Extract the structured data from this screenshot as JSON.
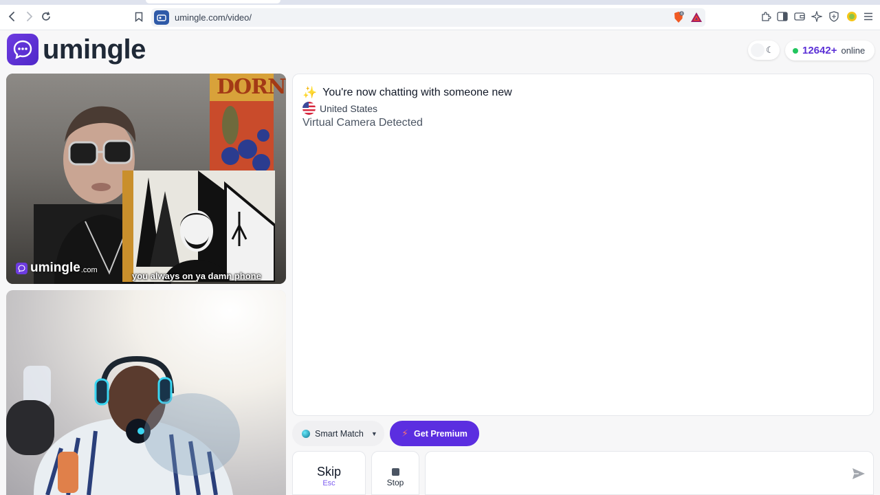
{
  "browser": {
    "url": "umingle.com/video/",
    "icons": [
      "back-icon",
      "forward-icon",
      "reload-icon",
      "bookmark-icon",
      "brave-shields-icon",
      "rewards-icon",
      "extensions-icon",
      "sidebar-icon",
      "wallet-icon",
      "leo-ai-icon",
      "vpn-icon",
      "profile-icon",
      "menu-icon"
    ]
  },
  "header": {
    "logo_text": "umingle",
    "online_count": "12642+",
    "online_label": "online"
  },
  "remote_video": {
    "watermark_text": "umingle",
    "watermark_suffix": ".com",
    "caption": "you always on ya damn phone",
    "poster_text": "DORN"
  },
  "chat": {
    "status_line": "You're now chatting with someone new",
    "country": "United States",
    "notice": "Virtual Camera Detected"
  },
  "controls": {
    "smart_match_label": "Smart Match",
    "premium_label": "Get Premium",
    "skip_label": "Skip",
    "skip_key": "Esc",
    "stop_label": "Stop",
    "message_placeholder": ""
  },
  "colors": {
    "brand": "#5b2ee0",
    "online_dot": "#22c55e"
  }
}
